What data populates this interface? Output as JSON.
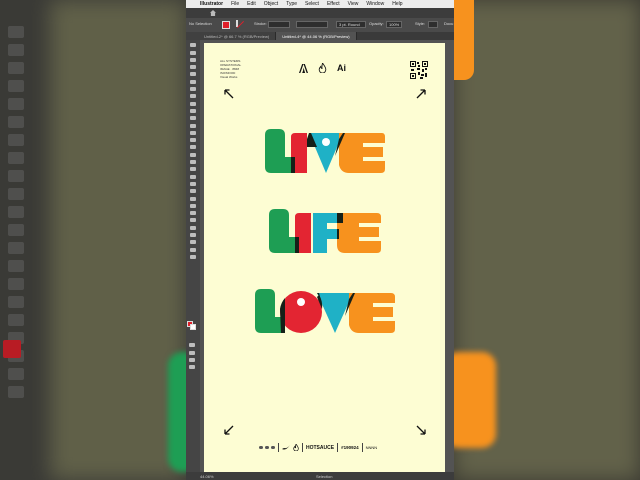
{
  "menubar": {
    "app_name": "Illustrator",
    "items": [
      "File",
      "Edit",
      "Object",
      "Type",
      "Select",
      "Effect",
      "View",
      "Window",
      "Help"
    ]
  },
  "control_bar": {
    "selection_label": "No Selection",
    "stroke_label": "Stroke:",
    "stroke_profile": "3 pt. Round",
    "opacity_label": "Opacity:",
    "opacity_value": "100%",
    "style_label": "Style:",
    "doc_setup": "Docu"
  },
  "tabs": [
    {
      "label": "Untitled-2* @ 66.7 % (RGB/Preview)",
      "active": false
    },
    {
      "label": "Untitled-4* @ 44.06 % (RGB/Preview)",
      "active": true
    }
  ],
  "artboard": {
    "background": "#fdfdd3",
    "info_lines": [
      "ALL SYSTEMS",
      "OPERATIONAL",
      "IMAGE · 8848",
      "ISO/MOOD",
      "Visual Works"
    ],
    "logo_text": "Ai",
    "words": [
      "LIVE",
      "LIFE",
      "LOVE"
    ],
    "footer": {
      "tag": "HOTSAUCE",
      "code": "#190924",
      "signature": "NNNN"
    }
  },
  "status_bar": {
    "zoom": "44.06%",
    "tool": "Selection"
  },
  "colors": {
    "green": "#1e9e54",
    "orange": "#f7921e",
    "teal": "#1fb1c6",
    "red": "#e32532",
    "overlap": "#152018",
    "ui_accent": "#e0202a"
  },
  "icons": [
    "apple-icon",
    "home-icon",
    "adobe-icon",
    "flame-icon",
    "qr-code-icon",
    "arrow-nw-icon",
    "arrow-ne-icon",
    "arrow-sw-icon",
    "arrow-se-icon"
  ]
}
